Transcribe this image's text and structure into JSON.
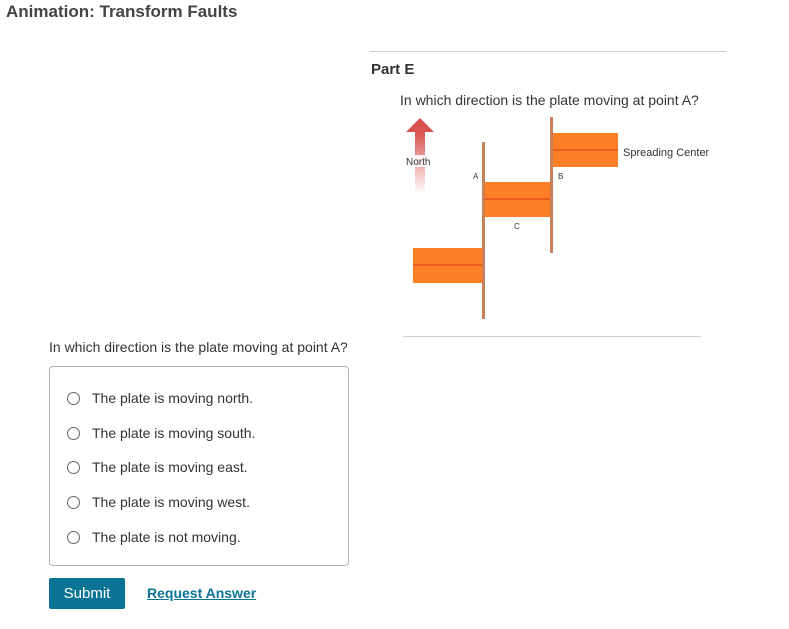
{
  "page": {
    "title": "Animation: Transform Faults"
  },
  "figure": {
    "part_label": "Part E",
    "question": "In which direction is the plate moving at point A?",
    "diagram": {
      "north_label": "North",
      "point_a": "A",
      "point_b": "B",
      "point_c": "C",
      "spreading_center_label": "Spreading Center",
      "colors": {
        "ridge_segment": "#ff7f27",
        "ridge_center_line": "#d43a1a",
        "fault_line": "#c8825a",
        "arrow": "#d9534f"
      },
      "arrow_icon": "north-arrow-icon"
    }
  },
  "question": {
    "text": "In which direction is the plate moving at point A?",
    "options": [
      {
        "label": "The plate is moving north."
      },
      {
        "label": "The plate is moving south."
      },
      {
        "label": "The plate is moving east."
      },
      {
        "label": "The plate is moving west."
      },
      {
        "label": "The plate is not moving."
      }
    ]
  },
  "actions": {
    "submit_label": "Submit",
    "request_answer_label": "Request Answer"
  },
  "colors": {
    "accent": "#0a7396"
  }
}
